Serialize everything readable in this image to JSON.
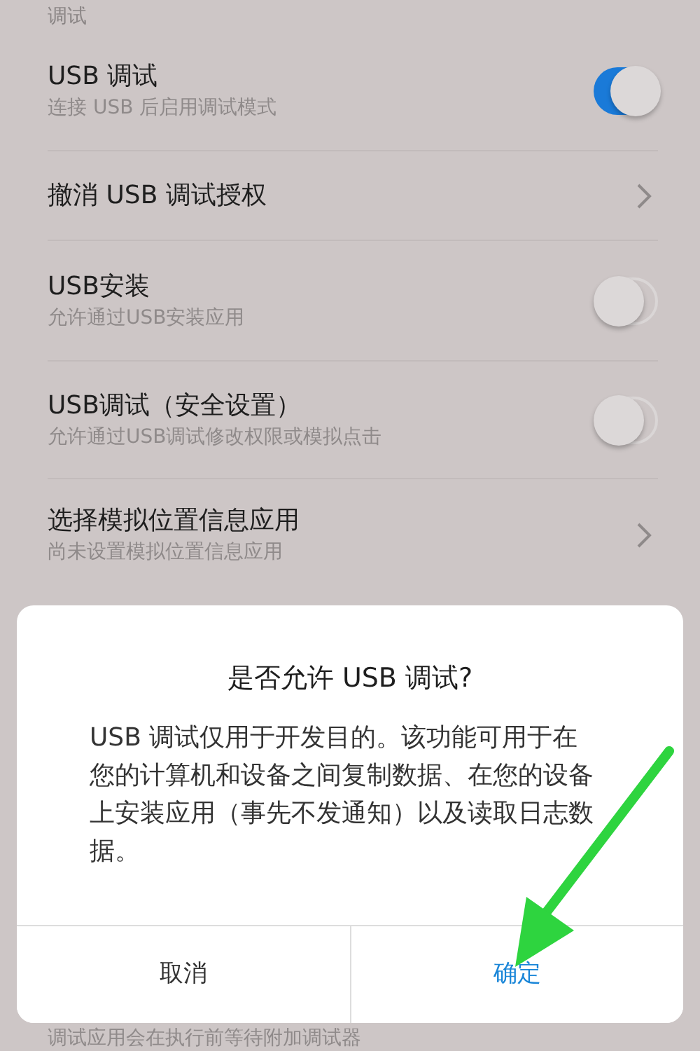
{
  "section_header": "调试",
  "settings": [
    {
      "kind": "toggle",
      "title": "USB 调试",
      "subtitle": "连接 USB 后启用调试模式",
      "on": true
    },
    {
      "kind": "link",
      "title": "撤消 USB 调试授权"
    },
    {
      "kind": "toggle",
      "title": "USB安装",
      "subtitle": "允许通过USB安装应用",
      "on": false
    },
    {
      "kind": "toggle",
      "title": "USB调试（安全设置）",
      "subtitle": "允许通过USB调试修改权限或模拟点击",
      "on": false
    },
    {
      "kind": "link",
      "title": "选择模拟位置信息应用",
      "subtitle": "尚未设置模拟位置信息应用"
    }
  ],
  "hidden_row_subtitle": "调试应用会在执行前等待附加调试器",
  "dialog": {
    "title": "是否允许 USB 调试?",
    "message": "USB 调试仅用于开发目的。该功能可用于在您的计算机和设备之间复制数据、在您的设备上安装应用（事先不发通知）以及读取日志数据。",
    "buttons": [
      {
        "label": "取消",
        "kind": "cancel"
      },
      {
        "label": "确定",
        "kind": "confirm"
      }
    ]
  }
}
